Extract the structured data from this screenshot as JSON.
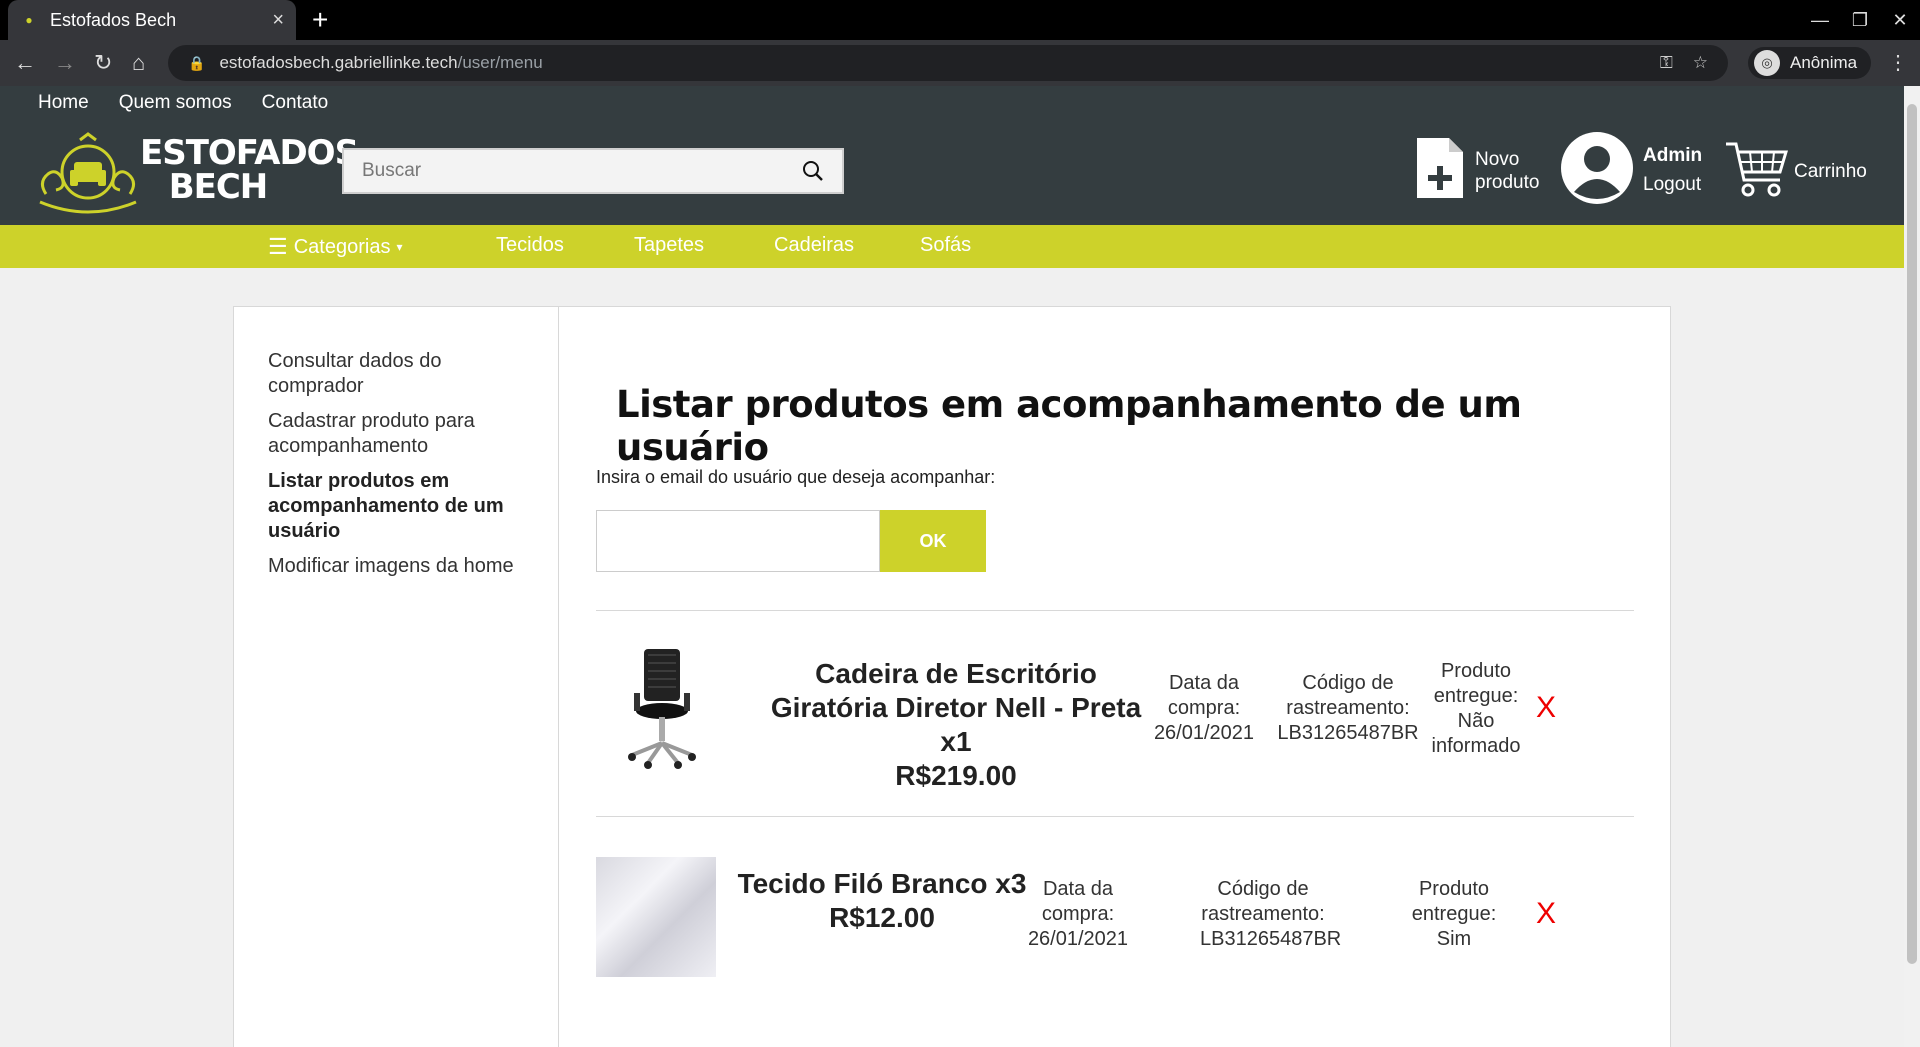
{
  "browser": {
    "tab_title": "Estofados Bech",
    "tab_close": "×",
    "new_tab": "+",
    "url_host": "estofadosbech.gabriellinke.tech",
    "url_path": "/user/menu",
    "profile": "Anônima"
  },
  "header": {
    "topnav": [
      "Home",
      "Quem somos",
      "Contato"
    ],
    "logo_line1": "ESTOFADOS",
    "logo_line2": "BECH",
    "search_placeholder": "Buscar",
    "new_product_line1": "Novo",
    "new_product_line2": "produto",
    "user_name": "Admin",
    "logout": "Logout",
    "cart": "Carrinho"
  },
  "categories": {
    "menu": "Categorias",
    "items": [
      "Tecidos",
      "Tapetes",
      "Cadeiras",
      "Sofás"
    ]
  },
  "sidebar": {
    "links": [
      "Consultar dados do comprador",
      "Cadastrar produto para acompanhamento",
      "Listar produtos em acompanhamento de um usuário",
      "Modificar imagens da home"
    ]
  },
  "main": {
    "title": "Listar produtos em acompanhamento de um usuário",
    "prompt": "Insira o email do usuário que deseja acompanhar:",
    "email_value": "",
    "ok_label": "OK"
  },
  "products": [
    {
      "name": "Cadeira de Escritório Giratória Diretor Nell - Preta x1",
      "price": "R$219.00",
      "date_label": "Data da compra:",
      "date": "26/01/2021",
      "tracking_label": "Código de rastreamento:",
      "tracking": "LB31265487BR",
      "delivered_label": "Produto entregue:",
      "delivered": "Não informado",
      "remove": "X"
    },
    {
      "name": "Tecido Filó Branco x3",
      "price": "R$12.00",
      "date_label": "Data da compra:",
      "date": "26/01/2021",
      "tracking_label": "Código de rastreamento:",
      "tracking": "LB31265487BR",
      "delivered_label": "Produto entregue:",
      "delivered": "Sim",
      "remove": "X"
    }
  ]
}
